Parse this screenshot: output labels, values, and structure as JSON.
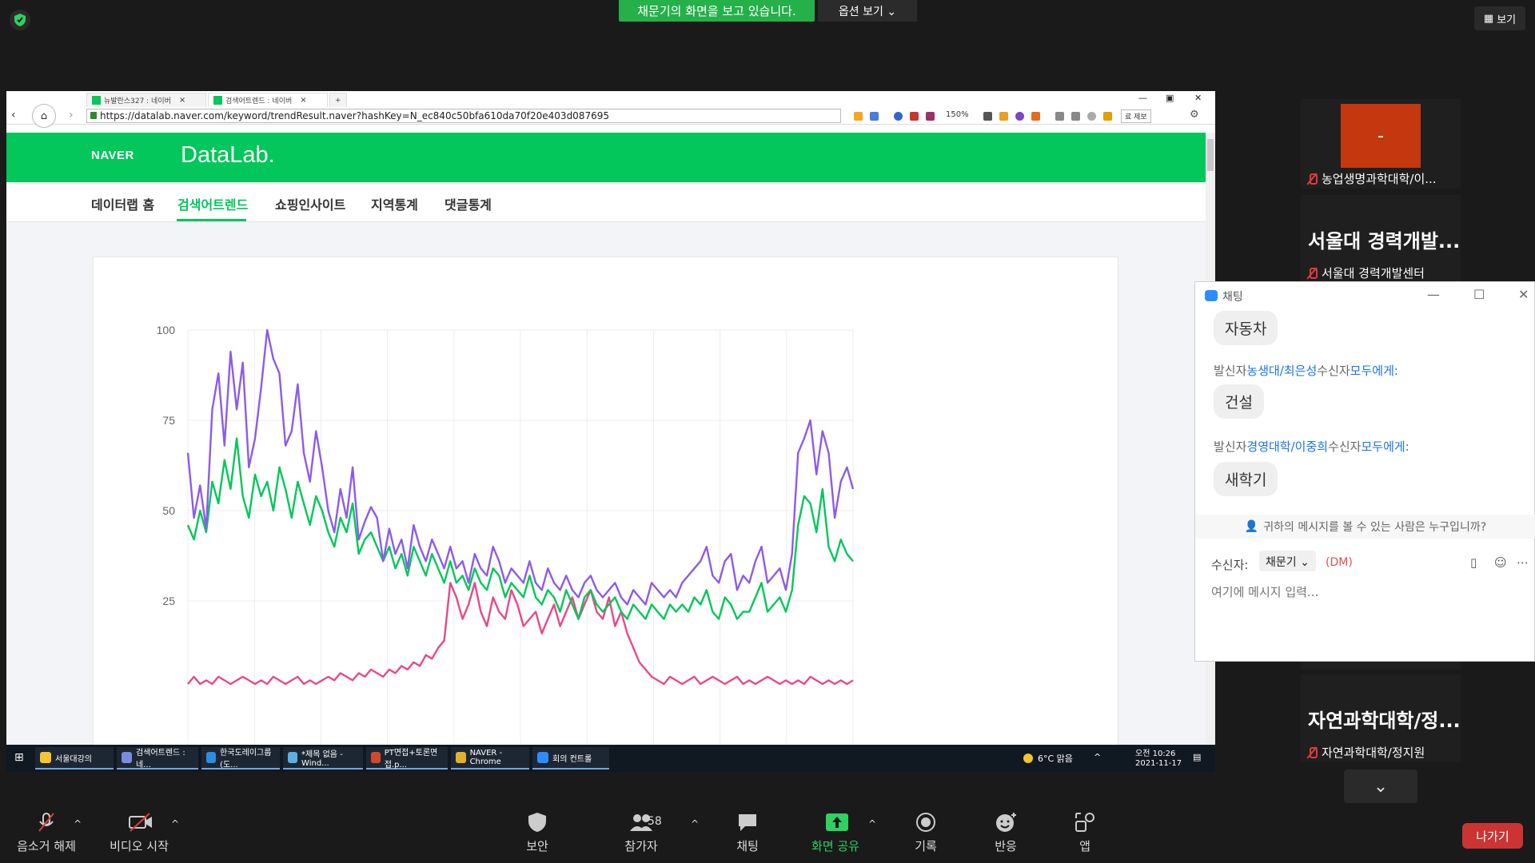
{
  "zoom": {
    "share_banner": "채문기의 화면을 보고 있습니다.",
    "view_options": "옵션 보기 ⌄",
    "view_label": "보기"
  },
  "browser": {
    "tabs": [
      {
        "label": "뉴발란스327 : 네이버"
      },
      {
        "label": "검색어트렌드 : 네이버"
      }
    ],
    "url": "https://datalab.naver.com/keyword/trendResult.naver?hashKey=N_ec840c50bfa610da70f20e403d087695",
    "zoom_level": "150%",
    "report_label": "료 제보"
  },
  "naver": {
    "logo": "NAVER",
    "product": "DataLab.",
    "nav": [
      "데이터랩 홈",
      "검색어트렌드",
      "쇼핑인사이트",
      "지역통계",
      "댓글통계"
    ],
    "active_nav": "검색어트렌드"
  },
  "chart_data": {
    "type": "line",
    "title": "",
    "xlabel": "",
    "ylabel": "",
    "ylim": [
      0,
      100
    ],
    "yticks": [
      100,
      75,
      50,
      25
    ],
    "grid": true,
    "series": [
      {
        "color": "#8c5bea",
        "values": [
          66,
          48,
          57,
          45,
          78,
          88,
          68,
          94,
          78,
          91,
          62,
          70,
          84,
          100,
          92,
          88,
          68,
          72,
          85,
          66,
          58,
          72,
          62,
          50,
          44,
          56,
          48,
          62,
          42,
          47,
          51,
          48,
          36,
          45,
          38,
          42,
          34,
          46,
          40,
          36,
          42,
          38,
          34,
          40,
          34,
          36,
          30,
          38,
          34,
          32,
          40,
          36,
          30,
          34,
          32,
          30,
          36,
          30,
          28,
          34,
          30,
          28,
          32,
          28,
          26,
          30,
          32,
          28,
          26,
          28,
          30,
          26,
          24,
          28,
          26,
          24,
          30,
          28,
          26,
          28,
          26,
          30,
          32,
          34,
          36,
          40,
          32,
          30,
          36,
          38,
          28,
          32,
          30,
          36,
          40,
          30,
          32,
          34,
          28,
          38,
          66,
          70,
          75,
          60,
          72,
          66,
          48,
          58,
          62,
          56
        ]
      },
      {
        "color": "#03c75a",
        "values": [
          46,
          42,
          50,
          44,
          58,
          52,
          64,
          56,
          70,
          54,
          48,
          60,
          54,
          58,
          50,
          62,
          56,
          48,
          58,
          52,
          46,
          54,
          50,
          44,
          40,
          48,
          44,
          52,
          38,
          42,
          44,
          40,
          36,
          40,
          34,
          38,
          32,
          40,
          36,
          32,
          38,
          34,
          30,
          36,
          30,
          32,
          28,
          34,
          30,
          28,
          34,
          32,
          26,
          30,
          28,
          26,
          32,
          26,
          24,
          28,
          26,
          22,
          28,
          24,
          20,
          26,
          28,
          24,
          22,
          24,
          26,
          22,
          20,
          24,
          22,
          20,
          24,
          22,
          20,
          24,
          22,
          24,
          22,
          26,
          24,
          28,
          22,
          20,
          26,
          24,
          20,
          22,
          22,
          26,
          30,
          22,
          24,
          26,
          22,
          28,
          46,
          54,
          52,
          44,
          56,
          40,
          36,
          42,
          38,
          36
        ]
      },
      {
        "color": "#e8488a",
        "values": [
          2,
          4,
          2,
          3,
          2,
          4,
          3,
          2,
          3,
          4,
          3,
          2,
          3,
          2,
          4,
          3,
          2,
          3,
          4,
          2,
          3,
          2,
          3,
          4,
          3,
          5,
          4,
          3,
          5,
          4,
          6,
          5,
          4,
          6,
          5,
          7,
          6,
          8,
          7,
          10,
          9,
          12,
          14,
          30,
          26,
          20,
          24,
          30,
          22,
          18,
          26,
          22,
          20,
          28,
          24,
          18,
          20,
          22,
          16,
          20,
          24,
          18,
          22,
          26,
          20,
          24,
          28,
          22,
          20,
          26,
          18,
          22,
          16,
          12,
          8,
          6,
          4,
          3,
          2,
          4,
          3,
          2,
          3,
          4,
          2,
          3,
          4,
          3,
          2,
          3,
          4,
          2,
          3,
          2,
          3,
          4,
          3,
          2,
          3,
          2,
          3,
          2,
          4,
          3,
          2,
          3,
          2,
          3,
          2,
          3
        ]
      }
    ]
  },
  "taskbar": {
    "items": [
      {
        "label": "서울대강의",
        "color": "#f4c531"
      },
      {
        "label": "검색어트렌드 : 네...",
        "color": "#7a8ce0"
      },
      {
        "label": "한국도레이그룹(도...",
        "color": "#2f8be0"
      },
      {
        "label": "*제목 없음 - Wind...",
        "color": "#5ab0e0"
      },
      {
        "label": "PT면접+토론면접.p...",
        "color": "#d04a2a"
      },
      {
        "label": "NAVER - Chrome",
        "color": "#e3b12a"
      },
      {
        "label": "회의 컨트롤",
        "color": "#2d8cff"
      }
    ],
    "weather": "6°C  맑음",
    "time": "오전 10:26",
    "date": "2021-11-17"
  },
  "gallery": [
    {
      "name": "농업생명과학대학/이...",
      "big": "",
      "has_video": true
    },
    {
      "name": "서울대 경력개발센터",
      "big": "서울대 경력개발..."
    },
    {
      "name": "자연과학대학/정지원",
      "big": "자연과학대학/정..."
    }
  ],
  "chat": {
    "title": "채팅",
    "messages": [
      {
        "text": "자동차"
      },
      {
        "sender_prefix": "발신자",
        "sender": "농생대/최은성",
        "to_prefix": "수신자",
        "to": "모두에게:",
        "text": "건설"
      },
      {
        "sender_prefix": "발신자",
        "sender": "경영대학/이중희",
        "to_prefix": "수신자",
        "to": "모두에게:",
        "text": "새학기"
      }
    ],
    "privacy": "귀하의 메시지를 볼 수 있는 사람은 누구입니까?",
    "recipient_label": "수신자:",
    "recipient": "채문기 ⌄",
    "dm": "(DM)",
    "placeholder": "여기에 메시지 입력..."
  },
  "toolbar": {
    "unmute": "음소거 해제",
    "start_video": "비디오 시작",
    "security": "보안",
    "participants": "참가자",
    "participant_count": "58",
    "chat": "채팅",
    "share": "화면 공유",
    "record": "기록",
    "reactions": "반응",
    "apps": "앱",
    "leave": "나가기"
  },
  "colors": {
    "zoom_green": "#25b04a",
    "naver_green": "#03c75a",
    "leave_red": "#cc3333",
    "link_blue": "#1a74e8"
  }
}
